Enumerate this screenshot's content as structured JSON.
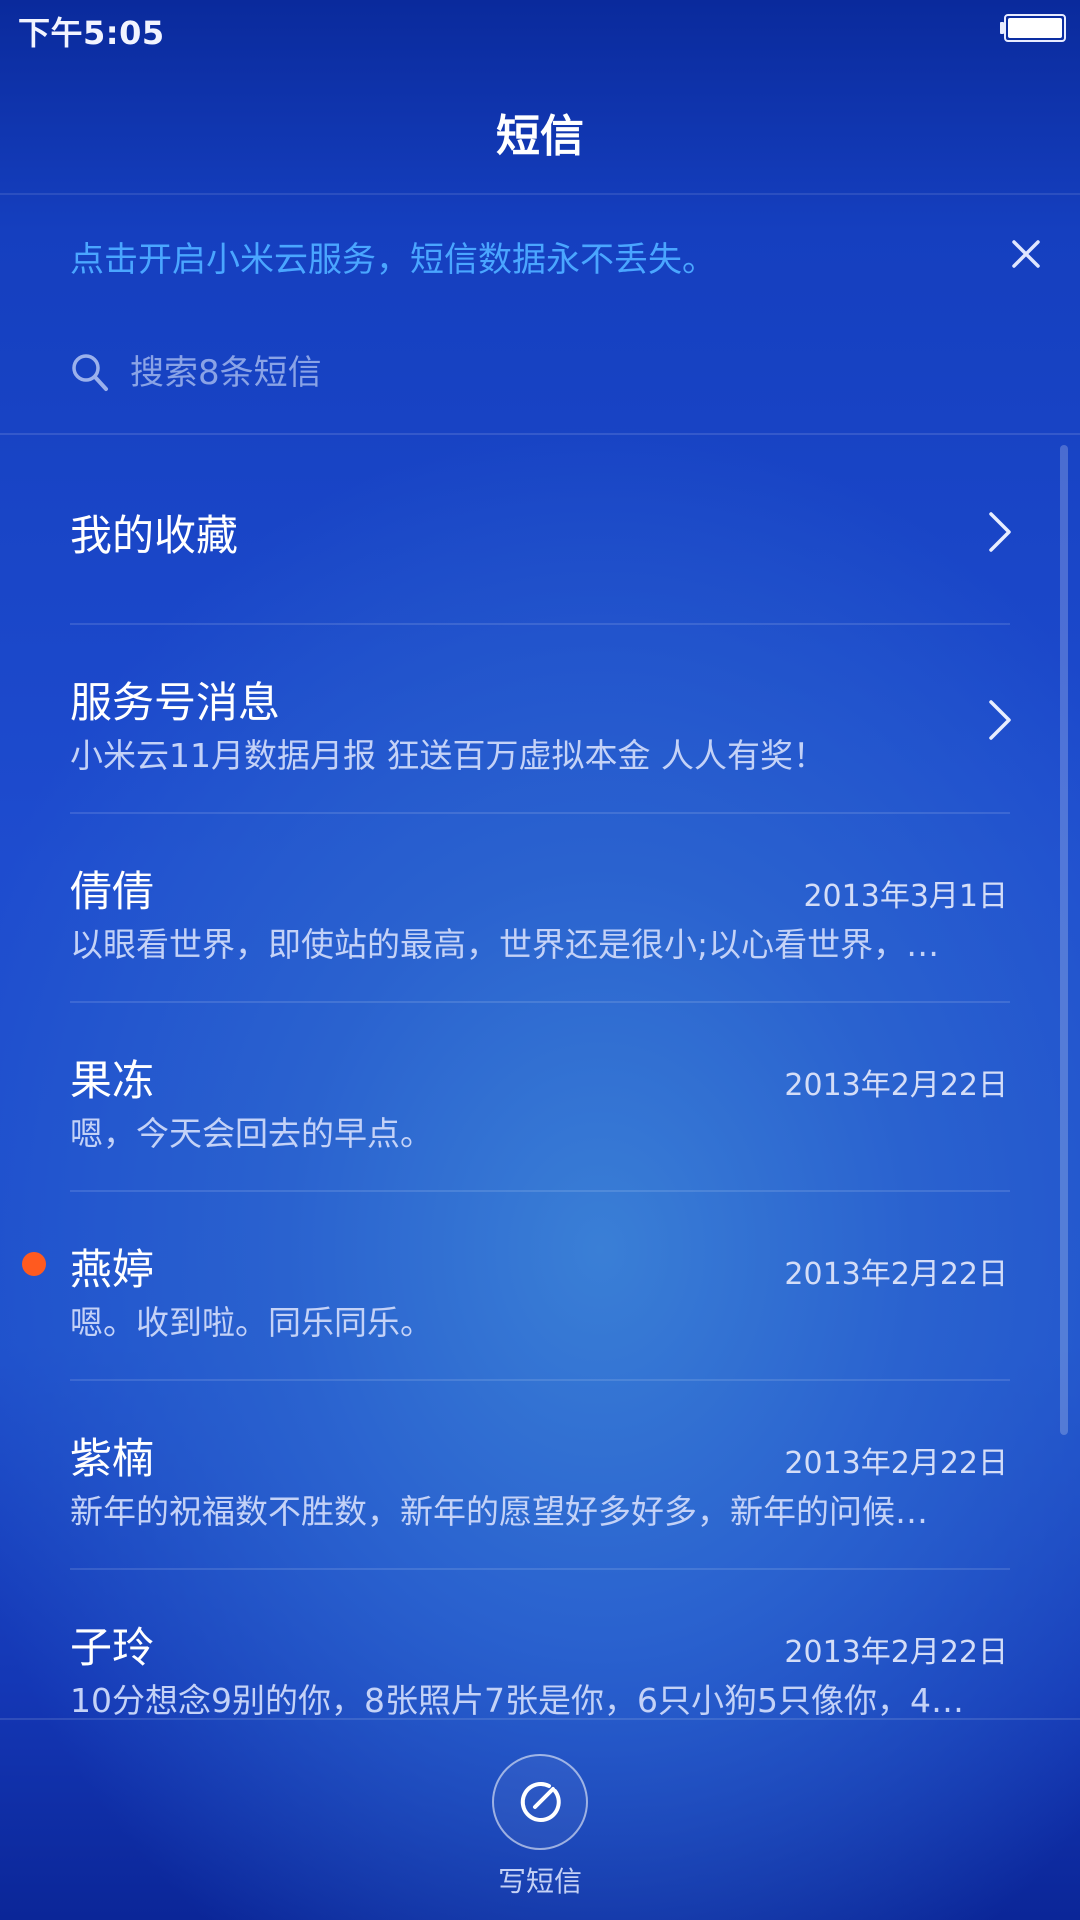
{
  "status_bar": {
    "time": "下午5:05"
  },
  "header": {
    "title": "短信"
  },
  "cloud_banner": {
    "text": "点击开启小米云服务，短信数据永不丢失。",
    "accent_color": "#4aa6ff"
  },
  "search": {
    "placeholder": "搜索8条短信"
  },
  "folders": [
    {
      "title": "我的收藏"
    },
    {
      "title": "服务号消息",
      "snippet": "小米云11月数据月报 狂送百万虚拟本金 人人有奖！"
    }
  ],
  "conversations": [
    {
      "name": "倩倩",
      "date": "2013年3月1日",
      "snippet": "以眼看世界，即使站的最高，世界还是很小;以心看世界，…",
      "unread": false
    },
    {
      "name": "果冻",
      "date": "2013年2月22日",
      "snippet": "嗯，今天会回去的早点。",
      "unread": false
    },
    {
      "name": "燕婷",
      "date": "2013年2月22日",
      "snippet": "嗯。收到啦。同乐同乐。",
      "unread": true
    },
    {
      "name": "紫楠",
      "date": "2013年2月22日",
      "snippet": "新年的祝福数不胜数，新年的愿望好多好多，新年的问候…",
      "unread": false
    },
    {
      "name": "子玲",
      "date": "2013年2月22日",
      "snippet": "10分想念9别的你，8张照片7张是你，6只小狗5只像你，4…",
      "unread": false
    }
  ],
  "compose": {
    "label": "写短信"
  },
  "colors": {
    "unread_dot": "#ff5a1f",
    "background_top": "#0a2a9c",
    "background_mid": "#2a62cf"
  }
}
